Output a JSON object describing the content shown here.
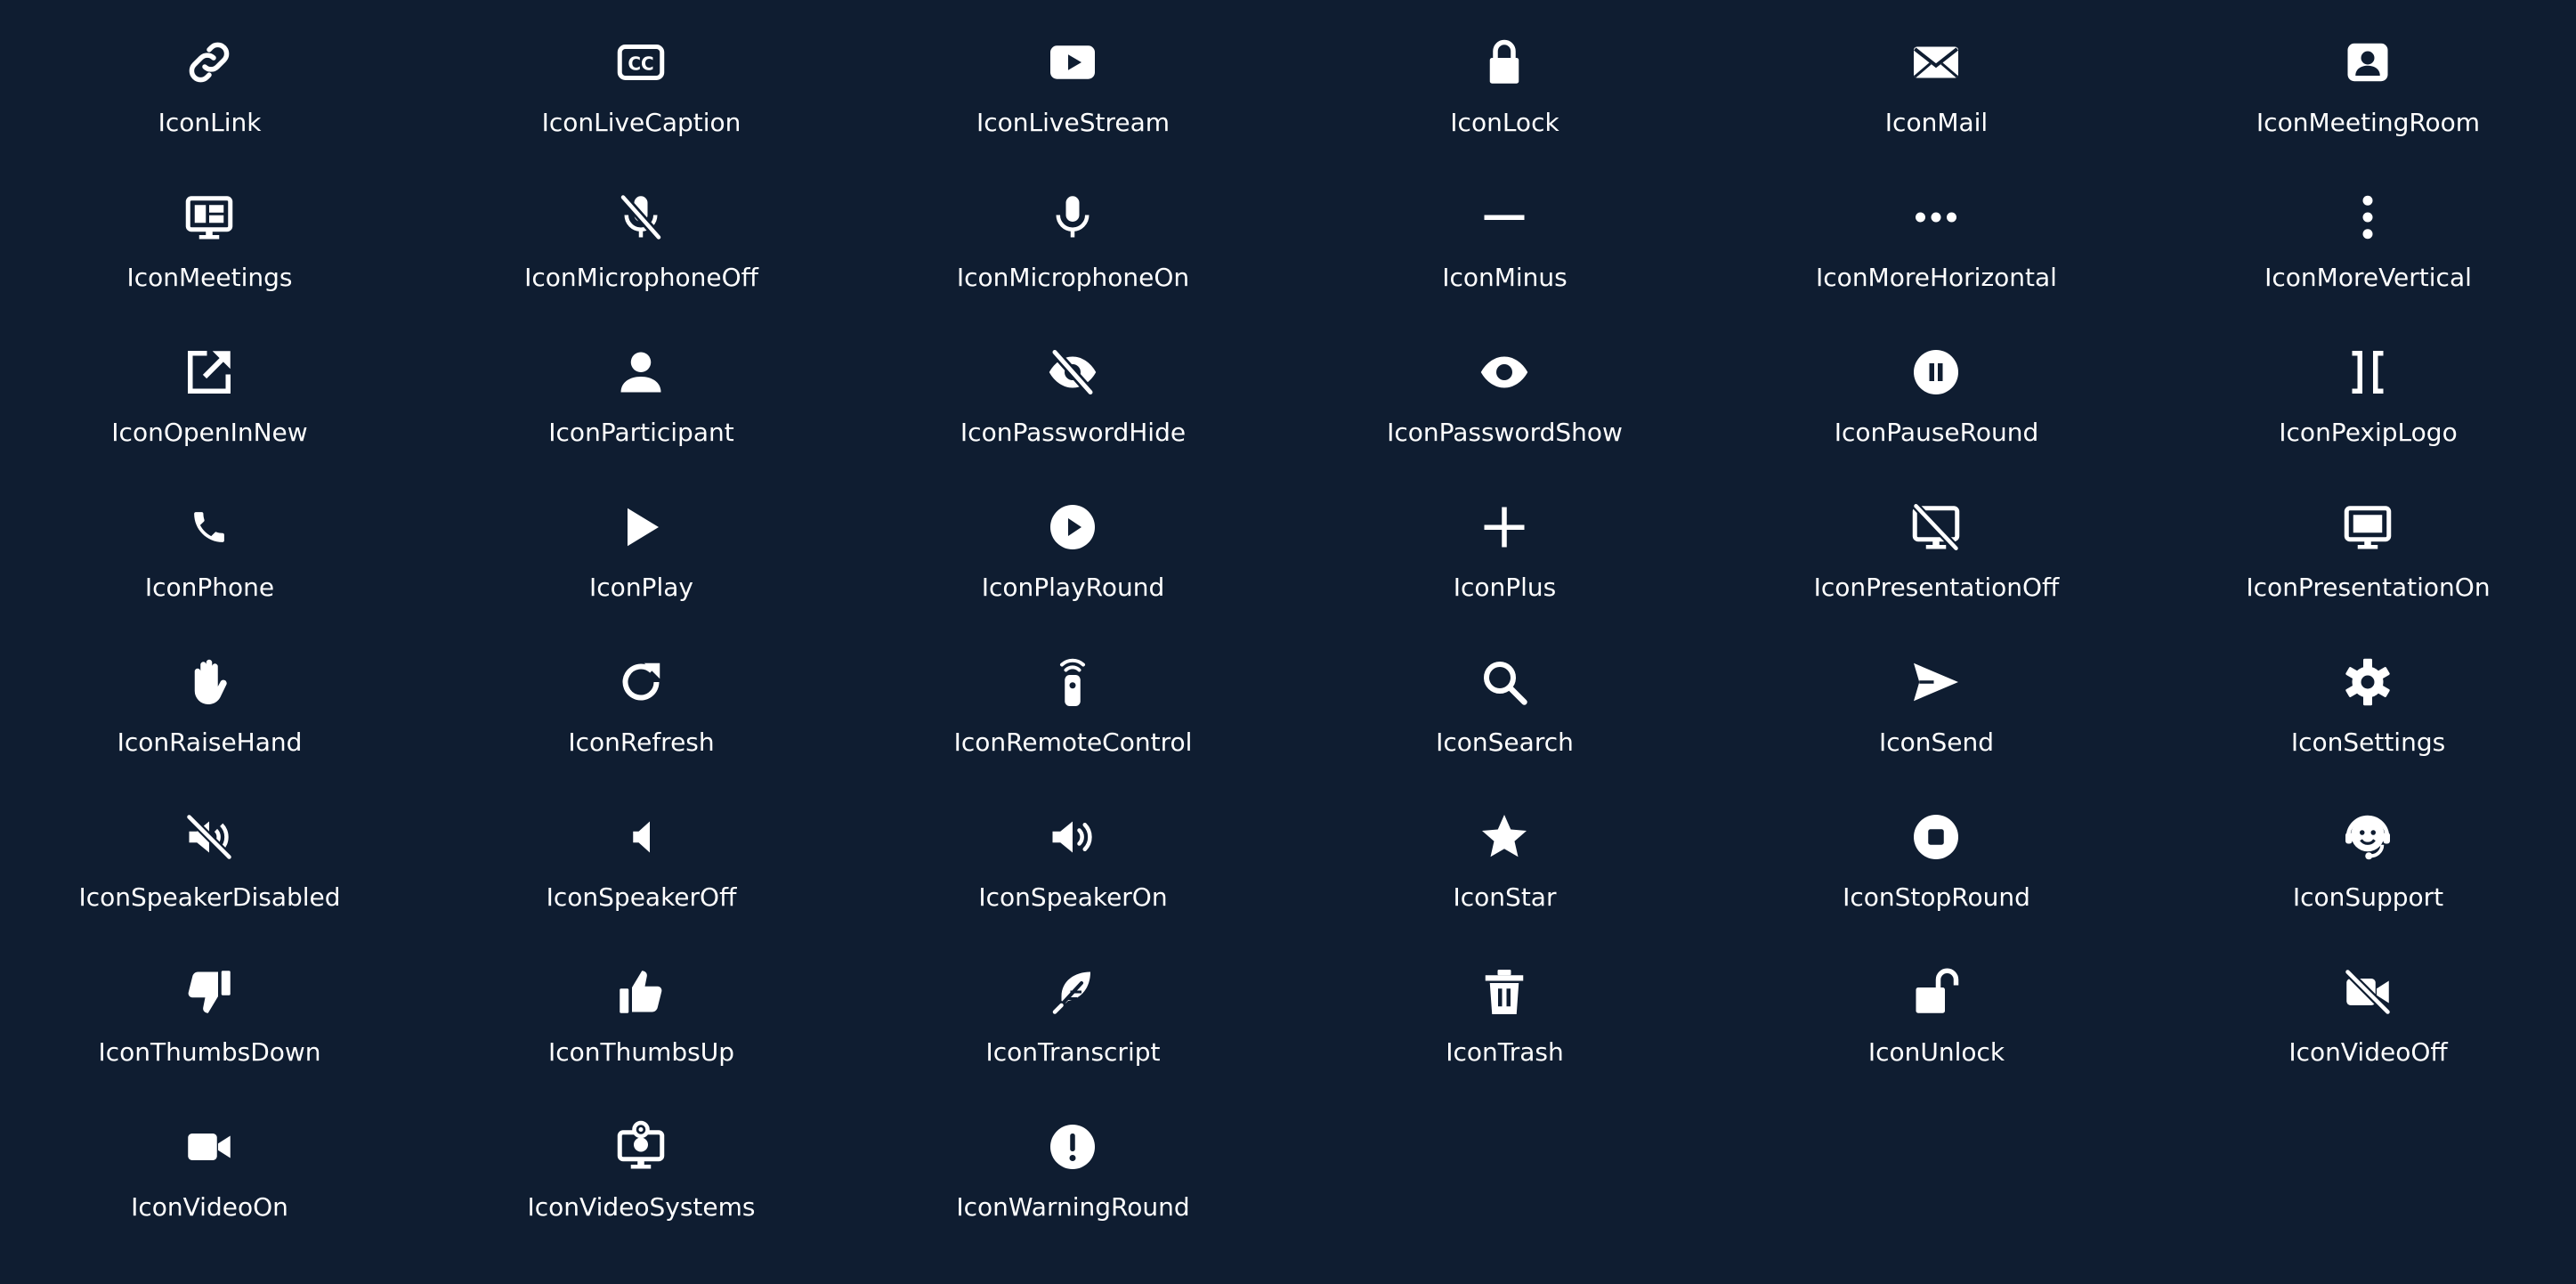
{
  "icons": [
    {
      "label": "IconLink",
      "icon": "link-icon"
    },
    {
      "label": "IconLiveCaption",
      "icon": "live-caption-icon"
    },
    {
      "label": "IconLiveStream",
      "icon": "live-stream-icon"
    },
    {
      "label": "IconLock",
      "icon": "lock-icon"
    },
    {
      "label": "IconMail",
      "icon": "mail-icon"
    },
    {
      "label": "IconMeetingRoom",
      "icon": "meeting-room-icon"
    },
    {
      "label": "IconMeetings",
      "icon": "meetings-icon"
    },
    {
      "label": "IconMicrophoneOff",
      "icon": "microphone-off-icon"
    },
    {
      "label": "IconMicrophoneOn",
      "icon": "microphone-on-icon"
    },
    {
      "label": "IconMinus",
      "icon": "minus-icon"
    },
    {
      "label": "IconMoreHorizontal",
      "icon": "more-horizontal-icon"
    },
    {
      "label": "IconMoreVertical",
      "icon": "more-vertical-icon"
    },
    {
      "label": "IconOpenInNew",
      "icon": "open-in-new-icon"
    },
    {
      "label": "IconParticipant",
      "icon": "participant-icon"
    },
    {
      "label": "IconPasswordHide",
      "icon": "password-hide-icon"
    },
    {
      "label": "IconPasswordShow",
      "icon": "password-show-icon"
    },
    {
      "label": "IconPauseRound",
      "icon": "pause-round-icon"
    },
    {
      "label": "IconPexipLogo",
      "icon": "pexip-logo-icon"
    },
    {
      "label": "IconPhone",
      "icon": "phone-icon"
    },
    {
      "label": "IconPlay",
      "icon": "play-icon"
    },
    {
      "label": "IconPlayRound",
      "icon": "play-round-icon"
    },
    {
      "label": "IconPlus",
      "icon": "plus-icon"
    },
    {
      "label": "IconPresentationOff",
      "icon": "presentation-off-icon"
    },
    {
      "label": "IconPresentationOn",
      "icon": "presentation-on-icon"
    },
    {
      "label": "IconRaiseHand",
      "icon": "raise-hand-icon"
    },
    {
      "label": "IconRefresh",
      "icon": "refresh-icon"
    },
    {
      "label": "IconRemoteControl",
      "icon": "remote-control-icon"
    },
    {
      "label": "IconSearch",
      "icon": "search-icon"
    },
    {
      "label": "IconSend",
      "icon": "send-icon"
    },
    {
      "label": "IconSettings",
      "icon": "settings-icon"
    },
    {
      "label": "IconSpeakerDisabled",
      "icon": "speaker-disabled-icon"
    },
    {
      "label": "IconSpeakerOff",
      "icon": "speaker-off-icon"
    },
    {
      "label": "IconSpeakerOn",
      "icon": "speaker-on-icon"
    },
    {
      "label": "IconStar",
      "icon": "star-icon"
    },
    {
      "label": "IconStopRound",
      "icon": "stop-round-icon"
    },
    {
      "label": "IconSupport",
      "icon": "support-icon"
    },
    {
      "label": "IconThumbsDown",
      "icon": "thumbs-down-icon"
    },
    {
      "label": "IconThumbsUp",
      "icon": "thumbs-up-icon"
    },
    {
      "label": "IconTranscript",
      "icon": "transcript-icon"
    },
    {
      "label": "IconTrash",
      "icon": "trash-icon"
    },
    {
      "label": "IconUnlock",
      "icon": "unlock-icon"
    },
    {
      "label": "IconVideoOff",
      "icon": "video-off-icon"
    },
    {
      "label": "IconVideoOn",
      "icon": "video-on-icon"
    },
    {
      "label": "IconVideoSystems",
      "icon": "video-systems-icon"
    },
    {
      "label": "IconWarningRound",
      "icon": "warning-round-icon"
    }
  ],
  "colors": {
    "background": "#0f1d31",
    "foreground": "#ffffff"
  }
}
